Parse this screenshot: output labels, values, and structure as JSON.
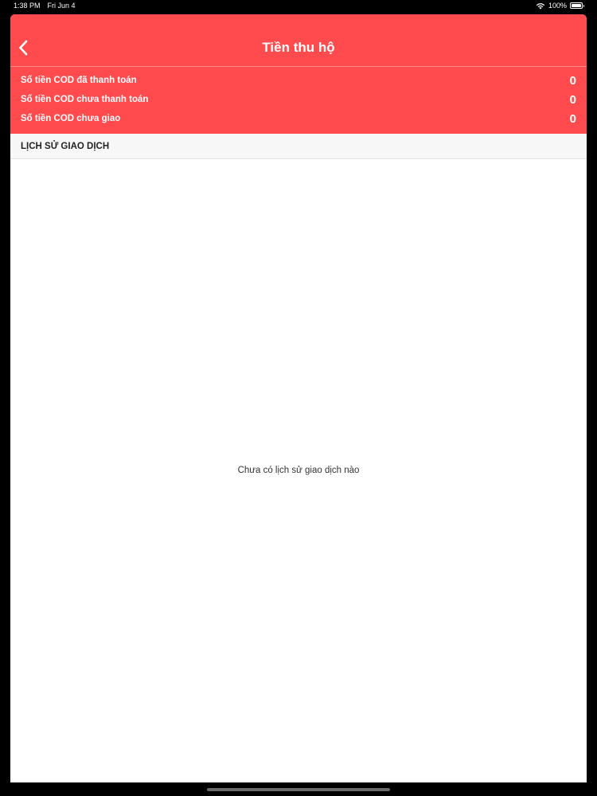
{
  "status_bar": {
    "time": "1:38 PM",
    "date": "Fri Jun 4",
    "battery": "100%",
    "icons": [
      "wifi-icon",
      "battery-icon"
    ]
  },
  "header": {
    "title": "Tiền thu hộ",
    "back_icon": "chevron-left-icon"
  },
  "summary": {
    "rows": [
      {
        "label": "Số tiền COD đã thanh toán",
        "value": "0"
      },
      {
        "label": "Số tiền COD chưa thanh toán",
        "value": "0"
      },
      {
        "label": "Số tiền COD chưa giao",
        "value": "0"
      }
    ]
  },
  "history": {
    "section_title": "LỊCH SỬ GIAO DỊCH",
    "empty_message": "Chưa có lịch sử giao dịch nào"
  },
  "colors": {
    "accent": "#ff4b4e",
    "background": "#ffffff",
    "section_header_bg": "#f7f7f7"
  }
}
